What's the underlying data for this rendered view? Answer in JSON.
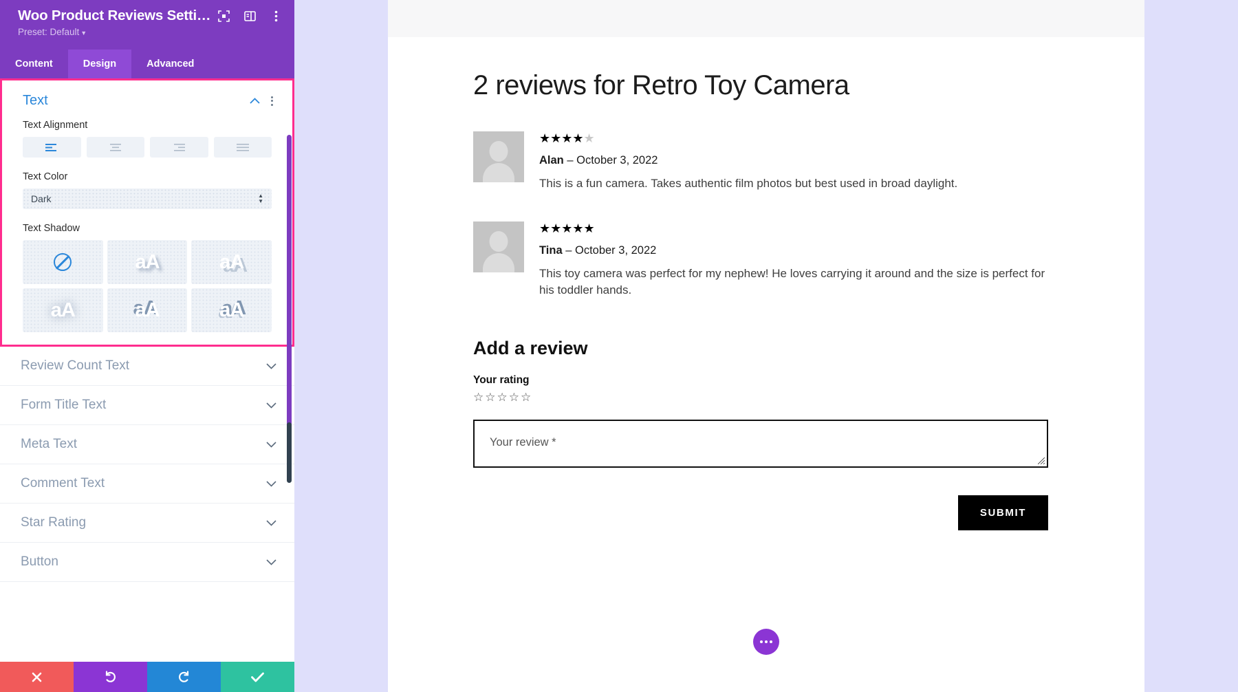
{
  "panel": {
    "title": "Woo Product Reviews Setti…",
    "preset": "Preset: Default",
    "header_icons": [
      {
        "name": "focus-icon"
      },
      {
        "name": "layout-icon"
      },
      {
        "name": "more-vertical-icon"
      }
    ],
    "tabs": [
      {
        "label": "Content",
        "active": false
      },
      {
        "label": "Design",
        "active": true
      },
      {
        "label": "Advanced",
        "active": false
      }
    ],
    "open_section": {
      "title": "Text",
      "collapse_icon": "chevron-up-icon",
      "options_icon": "more-vertical-icon",
      "text_alignment": {
        "label": "Text Alignment",
        "options": [
          "align-left",
          "align-center",
          "align-right",
          "align-justify"
        ],
        "selected": "align-left"
      },
      "text_color": {
        "label": "Text Color",
        "value": "Dark"
      },
      "text_shadow": {
        "label": "Text Shadow",
        "options": [
          {
            "name": "none",
            "glyph": "",
            "icon": "no-shadow-icon"
          },
          {
            "name": "shadow-soft-bottom-right",
            "glyph": "aA"
          },
          {
            "name": "shadow-hard-bottom-right",
            "glyph": "aA"
          },
          {
            "name": "shadow-glow",
            "glyph": "aA"
          },
          {
            "name": "shadow-top-left",
            "glyph": "aA"
          },
          {
            "name": "shadow-top-right",
            "glyph": "aA"
          }
        ],
        "selected": "none"
      }
    },
    "collapsed_sections": [
      {
        "label": "Review Count Text"
      },
      {
        "label": "Form Title Text"
      },
      {
        "label": "Meta Text"
      },
      {
        "label": "Comment Text"
      },
      {
        "label": "Star Rating"
      },
      {
        "label": "Button"
      }
    ],
    "footer_buttons": [
      {
        "name": "discard-button",
        "icon": "close-icon",
        "color": "#f15a5a"
      },
      {
        "name": "undo-button",
        "icon": "undo-icon",
        "color": "#8b35d4"
      },
      {
        "name": "redo-button",
        "icon": "redo-icon",
        "color": "#2387d6"
      },
      {
        "name": "save-button",
        "icon": "check-icon",
        "color": "#2ec2a0"
      }
    ]
  },
  "preview": {
    "reviews_title": "2 reviews for Retro Toy Camera",
    "reviews": [
      {
        "rating": 4,
        "max_rating": 5,
        "author": "Alan",
        "separator": " – ",
        "date": "October 3, 2022",
        "text": "This is a fun camera. Takes authentic film photos but best used in broad daylight."
      },
      {
        "rating": 5,
        "max_rating": 5,
        "author": "Tina",
        "separator": " – ",
        "date": "October 3, 2022",
        "text": "This toy camera was perfect for my nephew! He loves carrying it around and the size is perfect for his toddler hands."
      }
    ],
    "form": {
      "title": "Add a review",
      "rating_label": "Your rating",
      "rating_value": 0,
      "rating_max": 5,
      "review_placeholder": "Your review *",
      "review_value": "",
      "submit_label": "SUBMIT"
    },
    "fab": {
      "name": "more-options-fab",
      "icon": "ellipsis-icon",
      "color": "#8b35d4"
    }
  }
}
